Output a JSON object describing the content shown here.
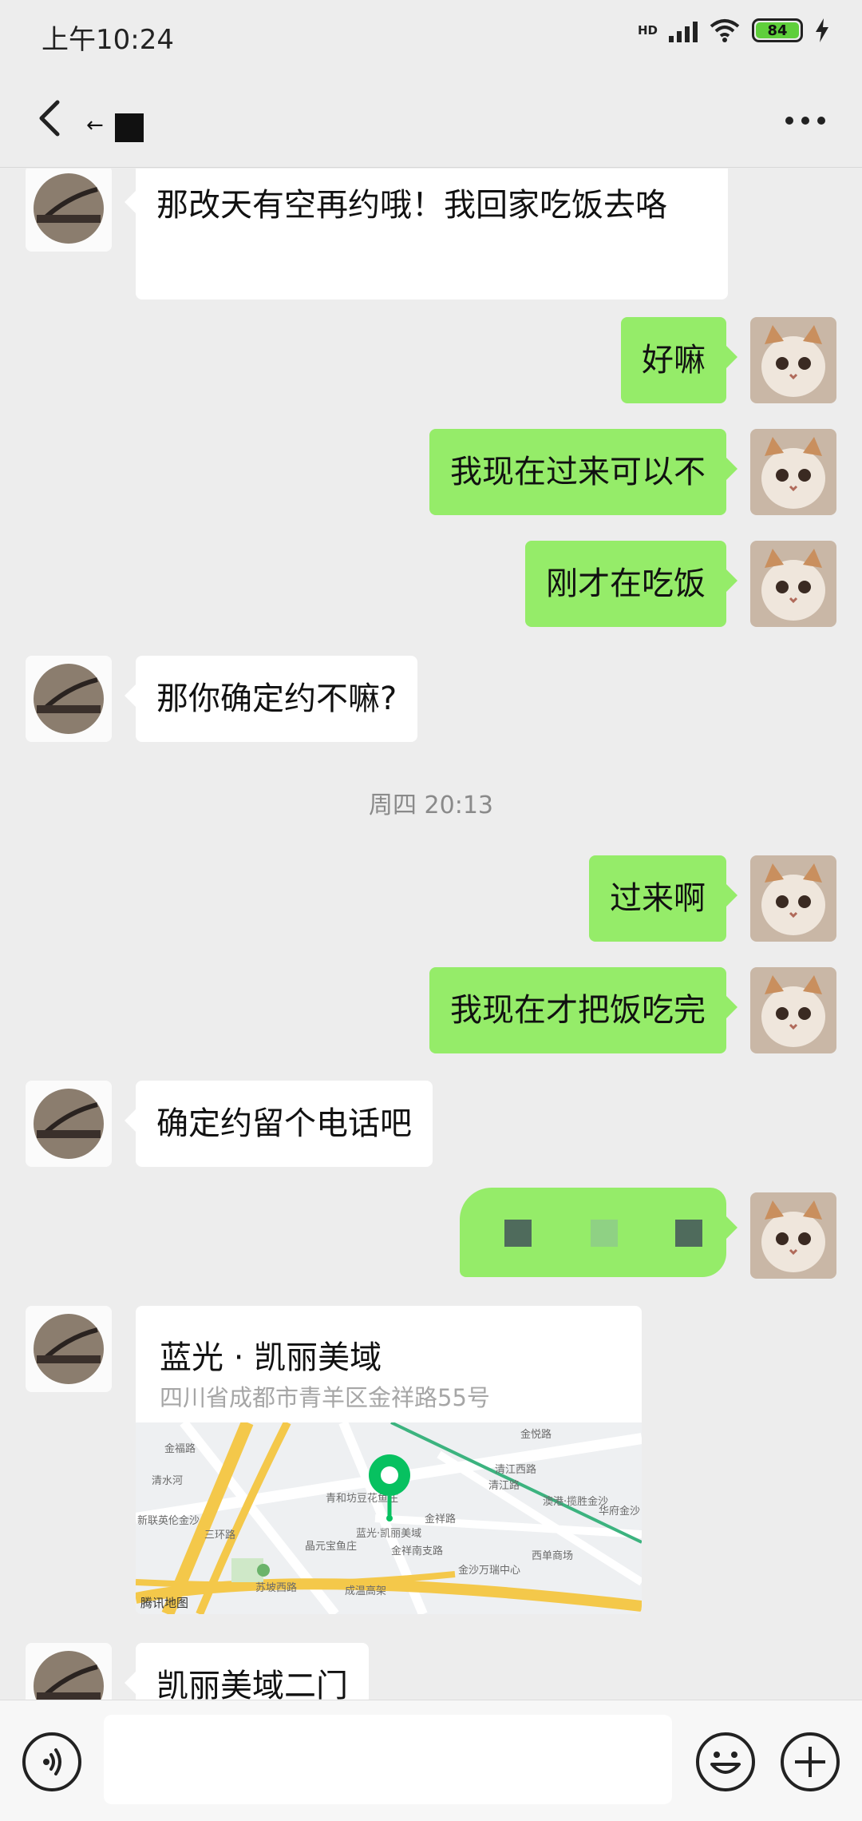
{
  "status_bar": {
    "time": "上午10:24",
    "network": "HD",
    "battery_level": "84"
  },
  "header": {
    "contact_name": "←"
  },
  "messages": [
    {
      "side": "in",
      "text": "那改天有空再约哦！我回家吃饭去咯"
    },
    {
      "side": "out",
      "text": "好嘛"
    },
    {
      "side": "out",
      "text": "我现在过来可以不"
    },
    {
      "side": "out",
      "text": "刚才在吃饭"
    },
    {
      "side": "in",
      "text": "那你确定约不嘛?"
    },
    {
      "side": "out",
      "text": "过来啊"
    },
    {
      "side": "out",
      "text": "我现在才把饭吃完"
    },
    {
      "side": "in",
      "text": "确定约留个电话吧"
    },
    {
      "side": "in",
      "text": "凯丽美域二门"
    }
  ],
  "timestamp": "周四 20:13",
  "location": {
    "title": "蓝光 · 凯丽美域",
    "address": "四川省成都市青羊区金祥路55号",
    "map_labels": [
      "金福路",
      "清江西路",
      "金祥路",
      "青和坊豆花鱼庄",
      "蓝光·凯丽美域",
      "金祥南支路",
      "三环路",
      "苏坡西路",
      "成温高架",
      "金沙万瑞中心",
      "西单商场",
      "华府金沙",
      "新联英伦金沙",
      "晶元宝鱼庄",
      "清水河",
      "金悦路",
      "清江路",
      "澳港·揽胜金沙"
    ],
    "map_credit": "腾讯地图"
  },
  "colors": {
    "outgoing_bubble": "#95ec69",
    "incoming_bubble": "#ffffff",
    "background": "#ededed",
    "map_pin": "#07c160"
  },
  "icons": {
    "back": "chevron-left-icon",
    "more": "more-dots-icon",
    "voice": "voice-icon",
    "emoji": "emoji-icon",
    "plus": "plus-icon"
  }
}
